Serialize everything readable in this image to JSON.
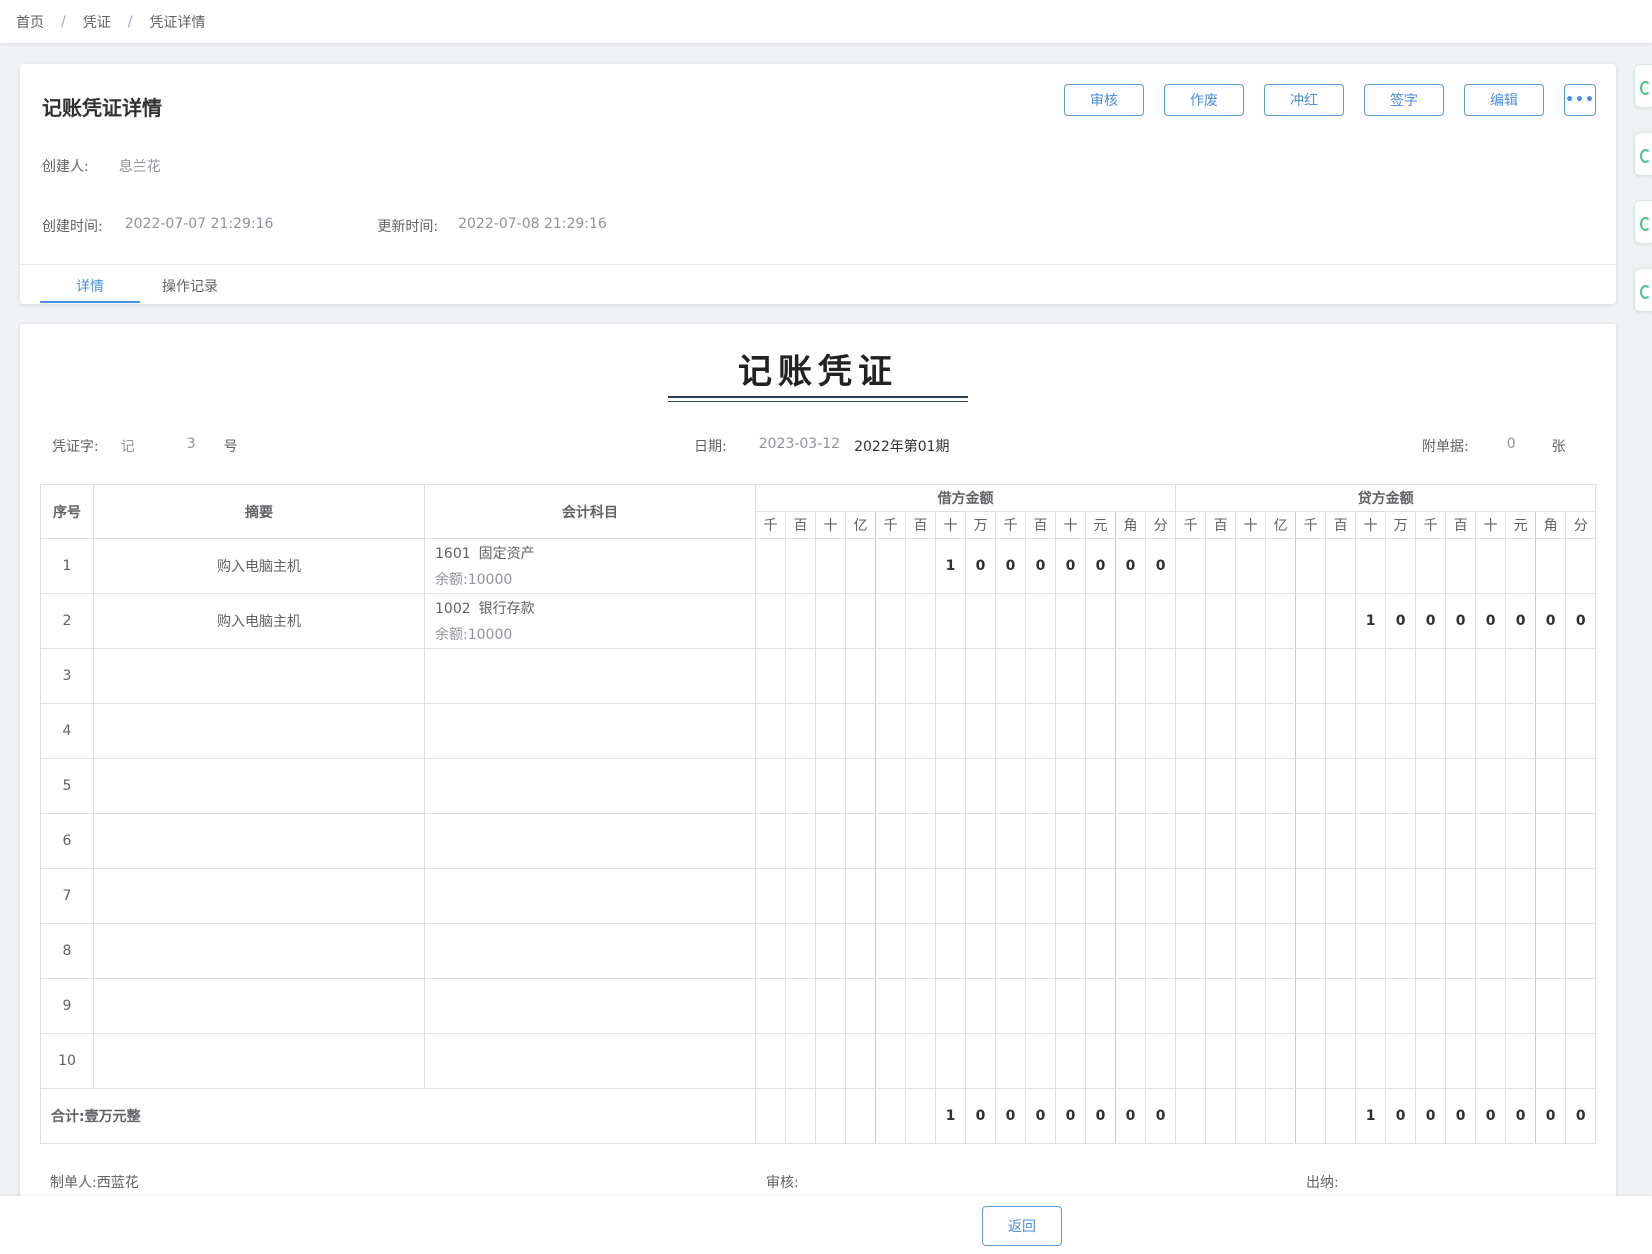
{
  "breadcrumb": [
    "首页",
    "凭证",
    "凭证详情"
  ],
  "header": {
    "title": "记账凭证详情",
    "actions": [
      "审核",
      "作废",
      "冲红",
      "签字",
      "编辑"
    ],
    "more_label": "•••",
    "creator_label": "创建人:",
    "creator": "息兰花",
    "created_label": "创建时间:",
    "created": "2022-07-07 21:29:16",
    "updated_label": "更新时间:",
    "updated": "2022-07-08 21:29:16",
    "tabs": [
      "详情",
      "操作记录"
    ]
  },
  "voucher": {
    "title": "记账凭证",
    "word_label": "凭证字:",
    "word": "记",
    "number": "3",
    "number_suffix": "号",
    "date_label": "日期:",
    "date": "2023-03-12",
    "period": "2022年第01期",
    "attach_label": "附单据:",
    "attach_count": "0",
    "attach_unit": "张",
    "columns": {
      "seq": "序号",
      "summary": "摘要",
      "subject": "会计科目",
      "debit": "借方金额",
      "credit": "贷方金额"
    },
    "digit_headers": [
      "千",
      "百",
      "十",
      "亿",
      "千",
      "百",
      "十",
      "万",
      "千",
      "百",
      "十",
      "元",
      "角",
      "分"
    ],
    "rows": [
      {
        "seq": "1",
        "summary": "购入电脑主机",
        "subject_code": "1601",
        "subject_name": "固定资产",
        "balance": "余额:10000",
        "debit": [
          "",
          "",
          "",
          "",
          "",
          "",
          "1",
          "0",
          "0",
          "0",
          "0",
          "0",
          "0",
          "0"
        ],
        "credit": [
          "",
          "",
          "",
          "",
          "",
          "",
          "",
          "",
          "",
          "",
          "",
          "",
          "",
          ""
        ]
      },
      {
        "seq": "2",
        "summary": "购入电脑主机",
        "subject_code": "1002",
        "subject_name": "银行存款",
        "balance": "余额:10000",
        "debit": [
          "",
          "",
          "",
          "",
          "",
          "",
          "",
          "",
          "",
          "",
          "",
          "",
          "",
          ""
        ],
        "credit": [
          "",
          "",
          "",
          "",
          "",
          "",
          "1",
          "0",
          "0",
          "0",
          "0",
          "0",
          "0",
          "0"
        ]
      },
      {
        "seq": "3"
      },
      {
        "seq": "4"
      },
      {
        "seq": "5"
      },
      {
        "seq": "6"
      },
      {
        "seq": "7"
      },
      {
        "seq": "8"
      },
      {
        "seq": "9"
      },
      {
        "seq": "10"
      }
    ],
    "total_label": "合计:壹万元整",
    "total_debit": [
      "",
      "",
      "",
      "",
      "",
      "",
      "1",
      "0",
      "0",
      "0",
      "0",
      "0",
      "0",
      "0"
    ],
    "total_credit": [
      "",
      "",
      "",
      "",
      "",
      "",
      "1",
      "0",
      "0",
      "0",
      "0",
      "0",
      "0",
      "0"
    ],
    "maker_label": "制单人:",
    "maker": "西蓝花",
    "auditor_label": "审核:",
    "cashier_label": "出纳:"
  },
  "footer": {
    "back_label": "返回"
  },
  "colors": {
    "accent": "#4a90e2",
    "side_tab": "#54c08c",
    "yuan_line": "#f5b8b8",
    "wan_line": "#a8d4ef"
  }
}
